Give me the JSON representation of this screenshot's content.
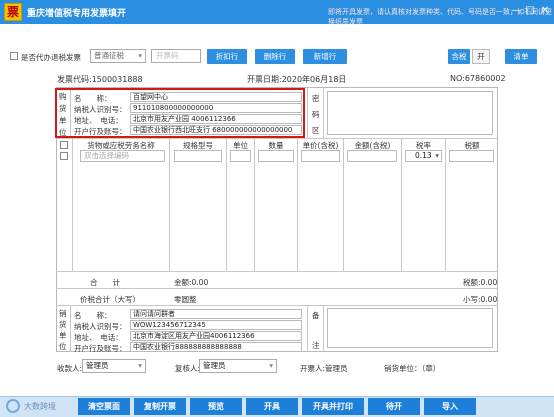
{
  "window": {
    "logo_char": "票",
    "title": "重庆增值税专用发票填开",
    "hint": "即将开具发票，请认真核对发票种类、代码、号码是否一致，如不同请更换纸质发票",
    "min": "—",
    "max": "□",
    "close": "✕"
  },
  "toolbar": {
    "agent_label": "是否代办退税发票",
    "collect_select": "普通征税",
    "invoice_code_placeholder": "开票码",
    "discount_btn": "折扣行",
    "delete_btn": "删除行",
    "add_btn": "新增行",
    "tax_incl_label": "含税",
    "tax_toggle": "开",
    "clear_btn": "清单"
  },
  "invoice": {
    "code": "发票代码:1500031888",
    "date": "开票日期:2020年06月18日",
    "no": "NO:67860002",
    "buyer_side": [
      "购",
      "货",
      "单",
      "位"
    ],
    "buyer": {
      "name_label": "名　　称：",
      "name": "百望网中心",
      "taxid_label": "纳税人识别号：",
      "taxid": "911010800000000000",
      "addr_label": "地址、　电话：",
      "addr": "北京市用友产业园 4006112366",
      "bank_label": "开户行及账号：",
      "bank": "中国农业银行西北旺支行 680000000000000000"
    },
    "pwd_side": [
      "密",
      "码",
      "区"
    ],
    "columns": [
      "货物或应税劳务名称",
      "规格型号",
      "单位",
      "数量",
      "单价(含税)",
      "金额(含税)",
      "税率",
      "税额"
    ],
    "item_placeholder": "双击选择编码",
    "tax_rate": "0.13",
    "total_label": "合　　计",
    "amount_total": "金额:0.00",
    "tax_total": "税额:0.00",
    "sum_label": "价税合计（大写）",
    "sum_upper": "零圆整",
    "sum_lower": "小写:0.00",
    "seller_side": [
      "销",
      "货",
      "单",
      "位"
    ],
    "seller": {
      "name_label": "名　　称：",
      "name": "请问请问群者",
      "taxid_label": "纳税人识别号：",
      "taxid": "WOW123456712345",
      "addr_label": "地址、　电话：",
      "addr": "北京市海淀区用友产业园4006112366",
      "bank_label": "开户行及账号：",
      "bank": "中国农业银行888888888888888"
    },
    "remark_side": [
      "备",
      "注"
    ]
  },
  "footer": {
    "payee_label": "收款人:",
    "payee": "管理员",
    "reviewer_label": "复核人:",
    "reviewer": "管理员",
    "drawer": "开票人:管理员",
    "seller_unit": "销货单位：（章）"
  },
  "bottom": {
    "brand": "大数跨境",
    "clear_btn": "清空票面",
    "copy_btn": "复制开票",
    "preview_btn": "预览",
    "issue_btn": "开具",
    "issue_print_btn": "开具并打印",
    "pending_btn": "待开",
    "import_btn": "导入"
  },
  "colors": {
    "titlebar": "#2a8fe0",
    "button": "#2e8ee0",
    "highlight": "#d31818"
  }
}
